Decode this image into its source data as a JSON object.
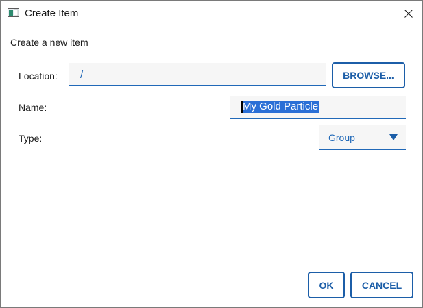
{
  "window": {
    "title": "Create Item",
    "app_icon": "window-app-icon",
    "close_icon": "close-icon"
  },
  "dialog": {
    "heading": "Create a new item",
    "location": {
      "label": "Location:",
      "value": "/"
    },
    "browse_label": "BROWSE...",
    "name": {
      "label": "Name:",
      "value": "My Gold Particle"
    },
    "type": {
      "label": "Type:",
      "selected": "Group",
      "arrow_icon": "dropdown-arrow-icon"
    },
    "ok_label": "OK",
    "cancel_label": "CANCEL"
  },
  "colors": {
    "accent": "#2169b8",
    "button_border": "#1c5ea8",
    "selection": "#2a6fd6",
    "field_background": "#f6f6f6"
  }
}
